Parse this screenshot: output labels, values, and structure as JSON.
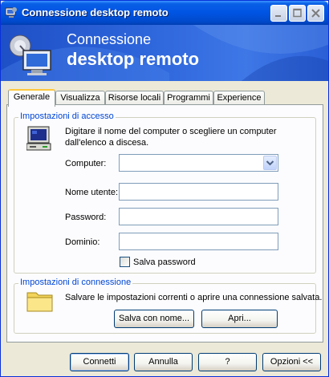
{
  "window": {
    "title": "Connessione desktop remoto"
  },
  "banner": {
    "line1": "Connessione",
    "line2": "desktop remoto"
  },
  "tabs": [
    "Generale",
    "Visualizza",
    "Risorse locali",
    "Programmi",
    "Experience"
  ],
  "access": {
    "group_title": "Impostazioni di accesso",
    "instructions": "Digitare il nome del computer o scegliere un computer dall'elenco a discesa.",
    "computer_label": "Computer:",
    "computer_value": "",
    "username_label": "Nome utente:",
    "username_value": "",
    "password_label": "Password:",
    "password_value": "",
    "domain_label": "Dominio:",
    "domain_value": "",
    "save_password_label": "Salva password"
  },
  "connection": {
    "group_title": "Impostazioni di connessione",
    "description": "Salvare le impostazioni correnti o aprire una connessione salvata.",
    "save_as_label": "Salva con nome...",
    "open_label": "Apri..."
  },
  "footer": {
    "connect_label": "Connetti",
    "cancel_label": "Annulla",
    "help_label": "?",
    "options_label": "Opzioni <<"
  },
  "icons": {
    "app": "remote-desktop-icon",
    "computer": "computer-icon",
    "folder": "folder-icon"
  },
  "colors": {
    "titlebar": "#0054e3",
    "group_title": "#0046d5",
    "tab_highlight": "#ffc83c"
  }
}
